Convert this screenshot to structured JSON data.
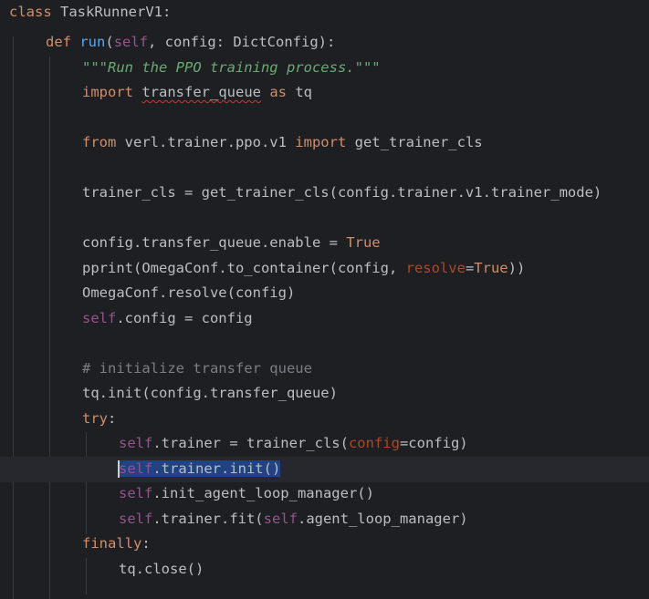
{
  "colors": {
    "background": "#1e1f22",
    "keyword": "#cf8e6d",
    "function": "#56a8f5",
    "self": "#94558d",
    "docstring": "#6aab73",
    "comment": "#7a7e85",
    "named_arg": "#aa4926",
    "text": "#bcbec4",
    "selection": "#214283"
  },
  "code": {
    "l01": {
      "t1": "class",
      "t2": " TaskRunnerV1:"
    },
    "l02": {
      "t1": "def",
      "t2": " ",
      "t3": "run",
      "t4": "(",
      "t5": "self",
      "t6": ", config: DictConfig):"
    },
    "l03": {
      "t1": "\"\"\"Run the PPO training process.\"\"\""
    },
    "l04": {
      "t1": "import",
      "t2": " ",
      "t3": "transfer_queue",
      "t4": " ",
      "t5": "as",
      "t6": " tq"
    },
    "l05": {
      "t1": "from",
      "t2": " verl.trainer.ppo.v1 ",
      "t3": "import",
      "t4": " get_trainer_cls"
    },
    "l06": {
      "t1": "trainer_cls = get_trainer_cls(config.trainer.v1.trainer_mode)"
    },
    "l07": {
      "t1": "config.transfer_queue.enable = ",
      "t2": "True"
    },
    "l08": {
      "t1": "pprint(OmegaConf.to_container(config, ",
      "t2": "resolve",
      "t3": "=",
      "t4": "True",
      "t5": "))"
    },
    "l09": {
      "t1": "OmegaConf.resolve(config)"
    },
    "l10": {
      "t1": "self",
      "t2": ".config = config"
    },
    "l11": {
      "t1": "# initialize transfer queue"
    },
    "l12": {
      "t1": "tq.init(config.transfer_queue)"
    },
    "l13": {
      "t1": "try",
      "t2": ":"
    },
    "l14": {
      "t1": "self",
      "t2": ".trainer = trainer_cls(",
      "t3": "config",
      "t4": "=config)"
    },
    "l15": {
      "t1": "self",
      "t2": ".trainer.init()"
    },
    "l16": {
      "t1": "self",
      "t2": ".init_agent_loop_manager()"
    },
    "l17": {
      "t1": "self",
      "t2": ".trainer.fit(",
      "t3": "self",
      "t4": ".agent_loop_manager)"
    },
    "l18": {
      "t1": "finally",
      "t2": ":"
    },
    "l19": {
      "t1": "tq.close()"
    }
  }
}
